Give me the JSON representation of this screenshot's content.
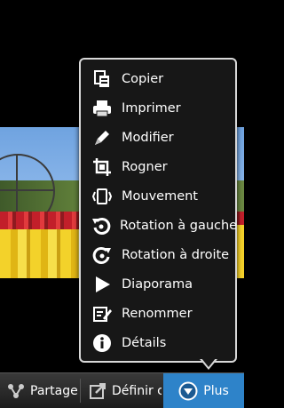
{
  "menu": {
    "items": [
      {
        "label": "Copier",
        "icon": "copy-icon"
      },
      {
        "label": "Imprimer",
        "icon": "print-icon"
      },
      {
        "label": "Modifier",
        "icon": "edit-icon"
      },
      {
        "label": "Rogner",
        "icon": "crop-icon"
      },
      {
        "label": "Mouvement",
        "icon": "motion-icon"
      },
      {
        "label": "Rotation à gauche",
        "icon": "rotate-left-icon"
      },
      {
        "label": "Rotation à droite",
        "icon": "rotate-right-icon"
      },
      {
        "label": "Diaporama",
        "icon": "slideshow-icon"
      },
      {
        "label": "Renommer",
        "icon": "rename-icon"
      },
      {
        "label": "Détails",
        "icon": "info-icon"
      }
    ]
  },
  "action_bar": {
    "share_label": "Partager",
    "set_as_label": "Définir c",
    "more_label": "Plus"
  },
  "colors": {
    "accent": "#2e83c9",
    "menu_bg": "#171717"
  }
}
